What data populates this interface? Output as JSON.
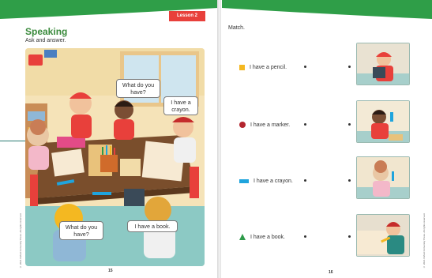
{
  "left_page": {
    "lesson_tab": "Lesson 2",
    "title": "Speaking",
    "subtitle": "Ask and answer.",
    "page_number": "15",
    "copyright": "© 2021 Oxford University Press. All rights reserved.",
    "bubbles": {
      "what_do_you_have_top": "What do you have?",
      "i_have_a_crayon": "I have a crayon.",
      "what_do_you_have_bottom": "What do you have?",
      "i_have_a_book": "I have a book."
    }
  },
  "right_page": {
    "instruction": "Match.",
    "page_number": "16",
    "copyright": "© 2021 Oxford University Press. All rights reserved.",
    "items": [
      {
        "label": "I have a pencil.",
        "marker_shape": "square",
        "marker_color": "#f4b821"
      },
      {
        "label": "I have a marker.",
        "marker_shape": "circle",
        "marker_color": "#b3252e"
      },
      {
        "label": "I have a crayon.",
        "marker_shape": "rectangle",
        "marker_color": "#1fa4dd"
      },
      {
        "label": "I have a book.",
        "marker_shape": "triangle",
        "marker_color": "#2e9a4a"
      }
    ]
  },
  "colors": {
    "header_green": "#2f9e48",
    "lesson_red": "#e8403b",
    "title_green": "#3a8a3c",
    "teal_accent": "#2a7a72"
  }
}
